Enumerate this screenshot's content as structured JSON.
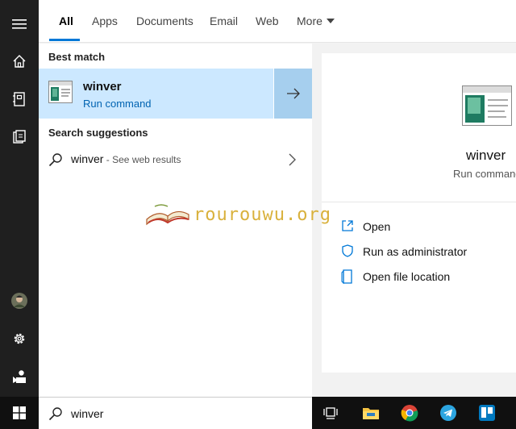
{
  "tabs": [
    {
      "label": "All",
      "active": true
    },
    {
      "label": "Apps"
    },
    {
      "label": "Documents"
    },
    {
      "label": "Email"
    },
    {
      "label": "Web"
    },
    {
      "label": "More"
    }
  ],
  "rail": {
    "items": [
      "hamburger-menu-icon",
      "home-icon",
      "notebook-icon",
      "documents-icon",
      "avatar",
      "gear-icon",
      "feedback-icon"
    ]
  },
  "results": {
    "best_match_title": "Best match",
    "best_match": {
      "name": "winver",
      "type": "Run command"
    },
    "suggestions_title": "Search suggestions",
    "suggestion": {
      "term": "winver",
      "suffix": " - See web results"
    }
  },
  "preview": {
    "name": "winver",
    "type": "Run command",
    "actions": [
      {
        "label": "Open",
        "icon": "open-icon"
      },
      {
        "label": "Run as administrator",
        "icon": "shield-icon"
      },
      {
        "label": "Open file location",
        "icon": "file-location-icon"
      }
    ]
  },
  "watermark": {
    "text": "rourouwu.org"
  },
  "search": {
    "value": "winver"
  },
  "taskbar": {
    "icons": [
      "windows-start-icon",
      "task-view-icon",
      "file-explorer-icon",
      "chrome-icon",
      "telegram-icon",
      "trello-icon"
    ]
  },
  "colors": {
    "accent": "#0078d7",
    "selection": "#cce8ff",
    "selection_arrow": "#a6cfee",
    "rail": "#1f1f1f"
  }
}
